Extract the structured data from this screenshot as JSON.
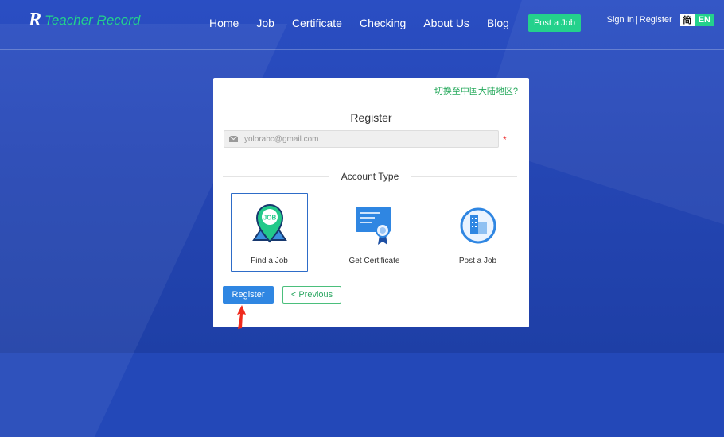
{
  "nav": {
    "logo_mark": "R",
    "logo_text": "Teacher Record",
    "items": [
      "Home",
      "Job",
      "Certificate",
      "Checking",
      "About Us",
      "Blog"
    ],
    "post_job_label": "Post a Job",
    "sign_in": "Sign In",
    "separator": "|",
    "register": "Register",
    "lang_flag": "简",
    "lang_en": "EN"
  },
  "card": {
    "switch_link": "切换至中国大陆地区?",
    "title": "Register",
    "email_value": "yolorabc@gmail.com",
    "required_mark": "*",
    "account_type_label": "Account Type",
    "types": [
      {
        "label": "Find a Job",
        "icon": "job-location-pin-icon",
        "selected": true
      },
      {
        "label": "Get Certificate",
        "icon": "certificate-icon",
        "selected": false
      },
      {
        "label": "Post a Job",
        "icon": "building-icon",
        "selected": false
      }
    ],
    "register_label": "Register",
    "previous_label": "< Previous",
    "pin_text": "JOB"
  },
  "colors": {
    "accent_green": "#24d18c",
    "primary_blue": "#2f86e2",
    "background_blue": "#2348b8"
  }
}
